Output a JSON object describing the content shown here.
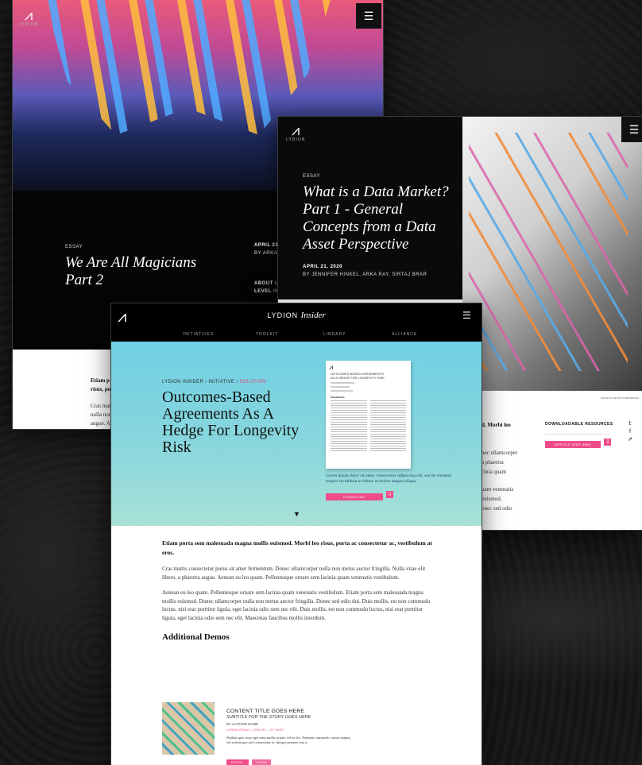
{
  "win1": {
    "logo_word": "LYDION",
    "eyebrow": "ESSAY",
    "title_l1": "We Are All Magicians",
    "title_l2": "Part 2",
    "date": "APRIL 21, 202",
    "by": "BY ARKA RA",
    "about_k": "ABOUT",
    "about_v": "LORE",
    "level_k": "LEVEL",
    "level_v": "INTER",
    "lead": "Etiam p",
    "lead2": "risus, po",
    "p1": "Cras matt",
    "p2": "nulla non",
    "p3": "augue. A"
  },
  "win2": {
    "logo_word": "LYDION",
    "eyebrow": "ESSAY",
    "title_l1": "What is a Data Market?",
    "title_l2": "Part 1 - General",
    "title_l3": "Concepts from a Data",
    "title_l4": "Asset Perspective",
    "date": "APRIL 21, 2020",
    "by": "BY JENNIFER HINKEL, ARKA RAY, SIRTAJ BRAR",
    "credit": "IMAGE BY METRO'S NEWSROOM",
    "lead_frag": "d. Morbi leo",
    "body_l1": "nec ullamcorper",
    "body_l2": "a pharetra",
    "body_l3": "cinia quam",
    "body_l4": "uam venenatis",
    "body_l5": "euismod.",
    "body_l6": "onec sed odio",
    "resources_title": "DOWNLOADABLE RESOURCES",
    "resource_btn": "ARTICLE (PDF 4Mb)"
  },
  "win3": {
    "brand": "LYDION",
    "brand_it": "Insider",
    "nav": [
      "INITIATIVES",
      "TOOLKIT",
      "LIBRARY",
      "ALLIANCE"
    ],
    "crumb_a": "LYDION INSIDER",
    "crumb_b": "INITIATIVE",
    "crumb_c": "SOLUTION",
    "title_l1": "Outcomes-Based",
    "title_l2": "Agreements As A",
    "title_l3": "Hedge For Longevity",
    "title_l4": "Risk",
    "doc_title_l1": "OUTCOMES-BASED AGREEMENTS",
    "doc_title_l2": "AS A HEDGE FOR LONGEVITY RISK",
    "doc_head": "Introduction",
    "caption_l1": "Lorem ipsum dolor sit amet, consectetur adipiscing elit, sed do eiusmod",
    "caption_l2": "tempor incididunt ut labore et dolore magna aliqua.",
    "download": "DOWNLOAD",
    "lead": "Etiam porta sem malesuada magna mollis euismod. Morbi leo risus, porta ac consectetur ac, vestibulum at eros.",
    "para1": "Cras mattis consectetur purus sit amet fermentum. Donec ullamcorper nulla non metus auctor fringilla. Nulla vitae elit libero, a pharetra augue. Aenean eu leo quam. Pellentesque ornare sem lacinia quam venenatis vestibulum.",
    "para2": "Aenean eu leo quam. Pellentesque ornare sem lacinia quam venenatis vestibulum. Etiam porta sem malesuada magna mollis euismod. Donec ullamcorper nulla non metus auctor fringilla. Donec sed odio dui. Duis mollis, est non commodo luctus, nisi erat porttitor ligula, eget lacinia odio sem nec elit. Duis mollis, est non commodo luctus, nisi erat porttitor ligula, eget lacinia odio sem nec elit. Maecenas faucibus mollis interdum.",
    "section": "Additional Demos",
    "card_title": "CONTENT TITLE GOES HERE",
    "card_sub": "SUBTITLE FOR THE STORY GOES HERE",
    "card_by": "BY AUTHOR NAME",
    "card_meta": "LOREM IPSUM — DOLOR — SIT AMET",
    "card_body": "Nullam quis risus eget urna mollis ornare vel eu leo. Praesent commodo cursus magna, vel scelerisque nisl consectetur et. Integer posuere erat a.",
    "card_btn1": "ESSAY",
    "card_btn2": "VIEW"
  },
  "colors": {
    "accent_pink": "#ef4d8a",
    "hero_teal": "#7fd4e0"
  }
}
